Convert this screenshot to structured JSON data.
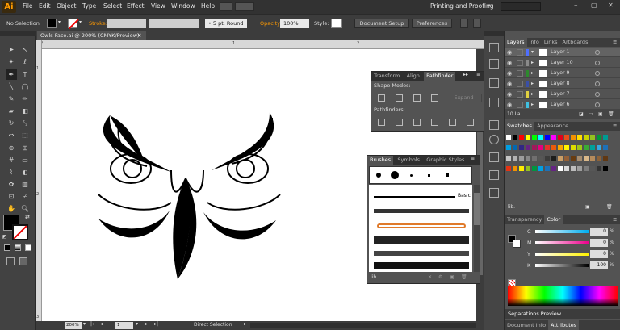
{
  "app": {
    "logo": "Ai"
  },
  "menus": [
    "File",
    "Edit",
    "Object",
    "Type",
    "Select",
    "Effect",
    "View",
    "Window",
    "Help"
  ],
  "workspace": "Printing and Proofing",
  "control": {
    "selection": "No Selection",
    "stroke_label": "Stroke:",
    "brush": "5 pt. Round",
    "opacity_label": "Opacity:",
    "opacity": "100%",
    "style_label": "Style:",
    "doc_setup": "Document Setup",
    "preferences": "Preferences"
  },
  "document": {
    "tab": "Owls Face.ai @ 200% (CMYK/Preview)"
  },
  "ruler": {
    "top_ticks": [
      "2",
      "1",
      "2"
    ],
    "left_ticks": [
      "1",
      "2",
      "3"
    ]
  },
  "status": {
    "zoom": "200%",
    "page": "1",
    "tool": "Direct Selection"
  },
  "transform_panel": {
    "tabs": [
      "Transform",
      "Align",
      "Pathfinder"
    ],
    "active": "Pathfinder",
    "shape_modes": "Shape Modes:",
    "expand": "Expand",
    "pathfinders": "Pathfinders:"
  },
  "brushes_panel": {
    "tabs": [
      "Brushes",
      "Symbols",
      "Graphic Styles"
    ],
    "active": "Brushes",
    "basic": "Basic"
  },
  "layers_panel": {
    "tabs": [
      "Layers",
      "Info",
      "Links",
      "Artboards"
    ],
    "active": "Layers",
    "layers": [
      {
        "name": "Layer 1",
        "color": "#4f6fff"
      },
      {
        "name": "Layer 10",
        "color": "#8a8a8a"
      },
      {
        "name": "Layer 9",
        "color": "#2d8a2d"
      },
      {
        "name": "Layer 8",
        "color": "#3a50a8"
      },
      {
        "name": "Layer 7",
        "color": "#e0d040"
      },
      {
        "name": "Layer 6",
        "color": "#40c0e0"
      }
    ],
    "footer": "10 La..."
  },
  "swatches_panel": {
    "tabs": [
      "Swatches",
      "Appearance"
    ],
    "active": "Swatches"
  },
  "color_panel": {
    "tabs": [
      "Transparency",
      "Color"
    ],
    "active": "Color",
    "channels": [
      {
        "label": "C",
        "value": "0",
        "pct": "%"
      },
      {
        "label": "M",
        "value": "0",
        "pct": "%"
      },
      {
        "label": "Y",
        "value": "0",
        "pct": "%"
      },
      {
        "label": "K",
        "value": "100",
        "pct": "%"
      }
    ]
  },
  "separations": {
    "label": "Separations Preview"
  },
  "bottom_tabs": [
    "Document Info",
    "Attributes"
  ]
}
